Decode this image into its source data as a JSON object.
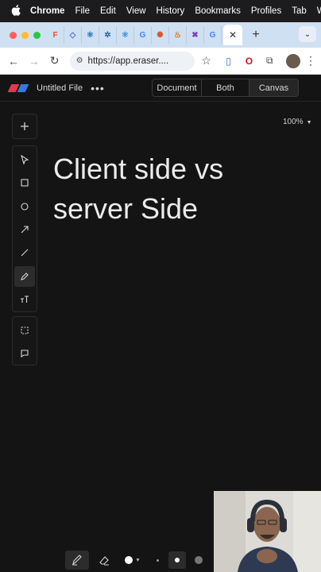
{
  "menubar": {
    "app_name": "Chrome",
    "items": [
      "File",
      "Edit",
      "View",
      "History",
      "Bookmarks",
      "Profiles",
      "Tab",
      "Wi"
    ]
  },
  "browser": {
    "url": "https://app.eraser....",
    "tab_icons": [
      "figma-icon",
      "gem-icon",
      "react-icon",
      "gear-icon",
      "react-icon",
      "google-icon",
      "asterisk-icon",
      "java-icon",
      "x-icon",
      "google-icon"
    ],
    "accent": "#cfe0f3"
  },
  "app": {
    "file_title": "Untitled File",
    "view_modes": [
      "Document",
      "Both",
      "Canvas"
    ],
    "active_view": "Canvas",
    "zoom": "100%",
    "canvas_text": "Client side vs\nserver Side"
  },
  "colors": {
    "background": "#141414",
    "logo_red": "#e5364a",
    "logo_blue": "#2f7de1"
  }
}
